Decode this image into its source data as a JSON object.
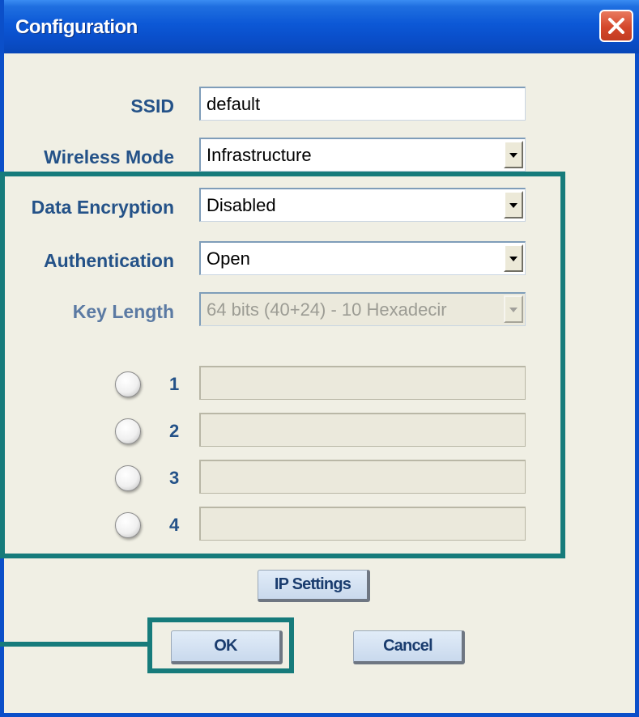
{
  "window": {
    "title": "Configuration"
  },
  "form": {
    "ssid": {
      "label": "SSID",
      "value": "default"
    },
    "wireless_mode": {
      "label": "Wireless Mode",
      "value": "Infrastructure"
    },
    "data_encryption": {
      "label": "Data Encryption",
      "value": "Disabled"
    },
    "authentication": {
      "label": "Authentication",
      "value": "Open"
    },
    "key_length": {
      "label": "Key Length",
      "value": "64 bits (40+24) - 10 Hexadecir"
    },
    "keys": [
      {
        "number": "1",
        "value": ""
      },
      {
        "number": "2",
        "value": ""
      },
      {
        "number": "3",
        "value": ""
      },
      {
        "number": "4",
        "value": ""
      }
    ]
  },
  "buttons": {
    "ip_settings": "IP Settings",
    "ok": "OK",
    "cancel": "Cancel"
  },
  "colors": {
    "highlight": "#167b7b",
    "label": "#245288",
    "titlebar": "#0a4fcb"
  },
  "icons": {
    "close": "close-x-icon",
    "dropdown": "chevron-down-icon"
  }
}
